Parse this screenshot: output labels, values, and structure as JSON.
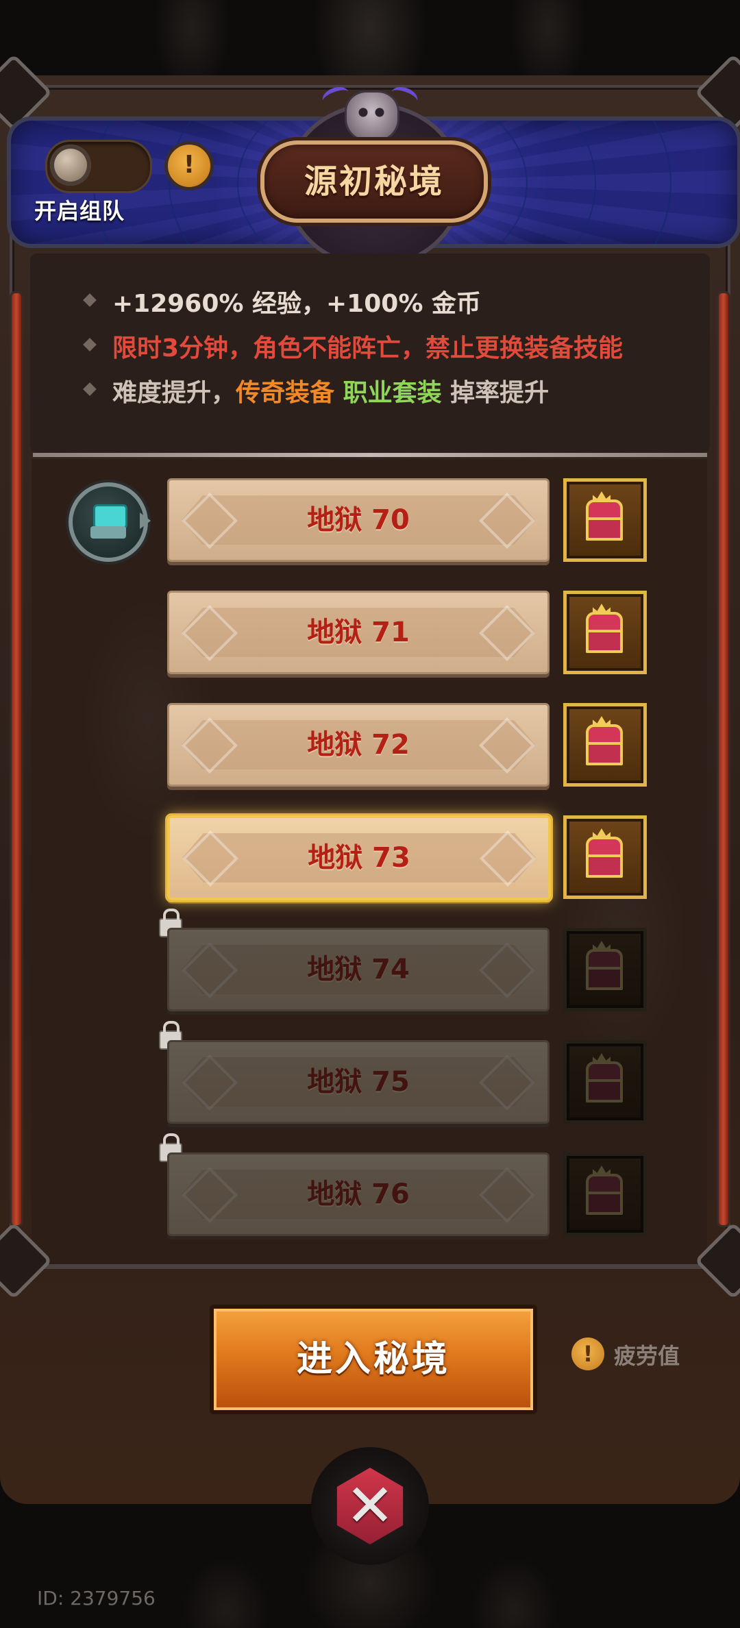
{
  "header": {
    "title": "源初秘境",
    "team_toggle_label": "开启组队",
    "team_toggle_on": false,
    "info_icon": "exclamation-icon"
  },
  "info": {
    "line1": "+12960% 经验，+100% 金币",
    "line2": "限时3分钟，角色不能阵亡，禁止更换装备技能",
    "line3_prefix": "难度提升，",
    "line3_legendary": "传奇装备",
    "line3_class_set": "职业套装",
    "line3_suffix": "掉率提升",
    "colors": {
      "normal": "#e8dcd2",
      "warning": "#e24a3b",
      "dim": "#cfc2b8",
      "legendary": "#f08a28",
      "class_set": "#8fd65a"
    }
  },
  "levels": [
    {
      "label": "地狱 70",
      "locked": false,
      "selected": false
    },
    {
      "label": "地狱 71",
      "locked": false,
      "selected": false
    },
    {
      "label": "地狱 72",
      "locked": false,
      "selected": false
    },
    {
      "label": "地狱 73",
      "locked": false,
      "selected": true
    },
    {
      "label": "地狱 74",
      "locked": true,
      "selected": false
    },
    {
      "label": "地狱 75",
      "locked": true,
      "selected": false
    },
    {
      "label": "地狱 76",
      "locked": true,
      "selected": false
    }
  ],
  "actions": {
    "enter_label": "进入秘境",
    "fatigue_label": "疲劳值",
    "fatigue_icon": "exclamation-icon",
    "close_icon": "close-x-icon"
  },
  "footer": {
    "player_id": "ID: 2379756"
  }
}
